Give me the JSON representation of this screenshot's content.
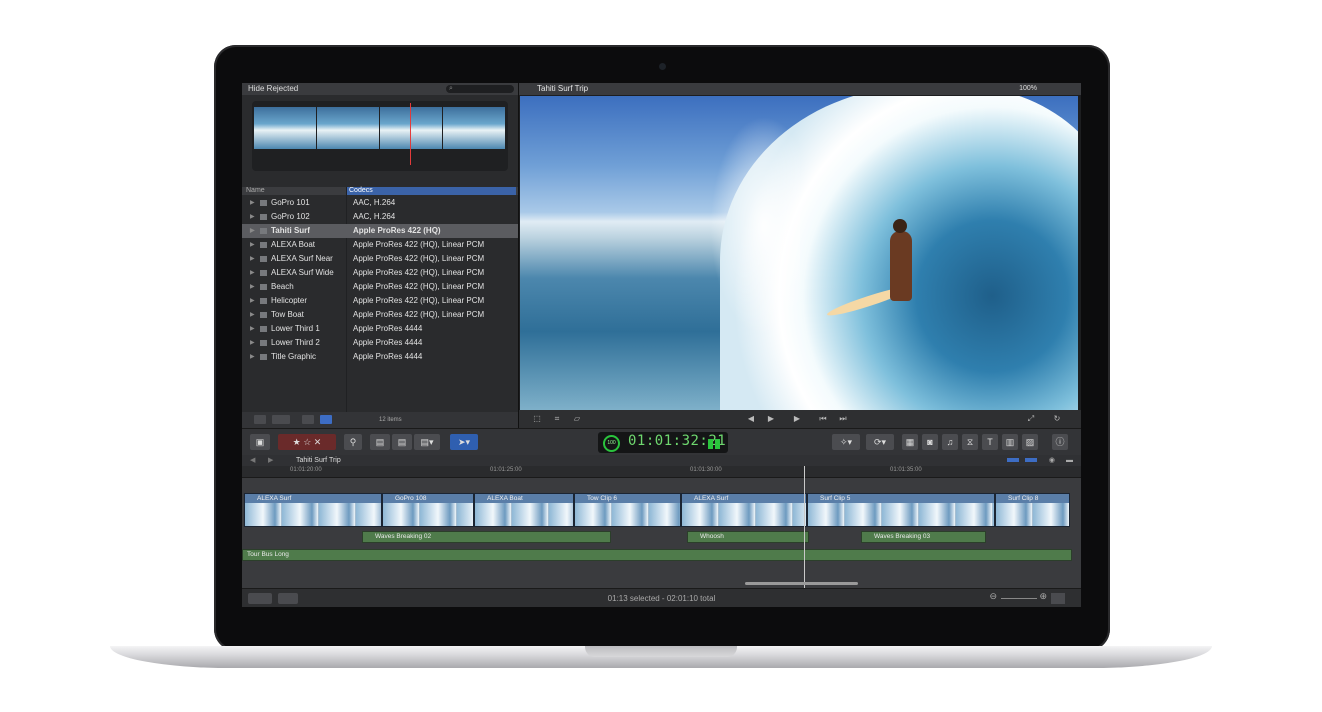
{
  "browser": {
    "filter_label": "Hide Rejected",
    "search_placeholder": "",
    "columns": {
      "name": "Name",
      "codecs": "Codecs"
    },
    "rows": [
      {
        "name": "GoPro 101",
        "codec": "AAC, H.264"
      },
      {
        "name": "GoPro 102",
        "codec": "AAC, H.264"
      },
      {
        "name": "Tahiti Surf",
        "codec": "Apple ProRes 422 (HQ)"
      },
      {
        "name": "ALEXA Boat",
        "codec": "Apple ProRes 422 (HQ), Linear PCM"
      },
      {
        "name": "ALEXA Surf Near",
        "codec": "Apple ProRes 422 (HQ), Linear PCM"
      },
      {
        "name": "ALEXA Surf Wide",
        "codec": "Apple ProRes 422 (HQ), Linear PCM"
      },
      {
        "name": "Beach",
        "codec": "Apple ProRes 422 (HQ), Linear PCM"
      },
      {
        "name": "Helicopter",
        "codec": "Apple ProRes 422 (HQ), Linear PCM"
      },
      {
        "name": "Tow Boat",
        "codec": "Apple ProRes 422 (HQ), Linear PCM"
      },
      {
        "name": "Lower Third 1",
        "codec": "Apple ProRes 4444"
      },
      {
        "name": "Lower Third 2",
        "codec": "Apple ProRes 4444"
      },
      {
        "name": "Title Graphic",
        "codec": "Apple ProRes 4444"
      }
    ],
    "item_count": "12 items"
  },
  "viewer": {
    "title": "Tahiti Surf Trip",
    "zoom": "100%"
  },
  "toolbar": {
    "timecode": "01:01:32:21",
    "ring_value": "100"
  },
  "timeline": {
    "project_name": "Tahiti Surf Trip",
    "ruler": [
      "01:01:20:00",
      "01:01:25:00",
      "01:01:30:00",
      "01:01:35:00"
    ],
    "video_clips": [
      "ALEXA Surf",
      "GoPro 108",
      "ALEXA Boat",
      "Tow Clip 6",
      "ALEXA Surf",
      "Surf Clip 5",
      "Surf Clip 8"
    ],
    "audio_clips": [
      "Waves Breaking 02",
      "Whoosh",
      "Waves Breaking 03"
    ],
    "music_clip": "Tour Bus Long"
  },
  "status": {
    "text": "01:13 selected - 02:01:10 total"
  }
}
